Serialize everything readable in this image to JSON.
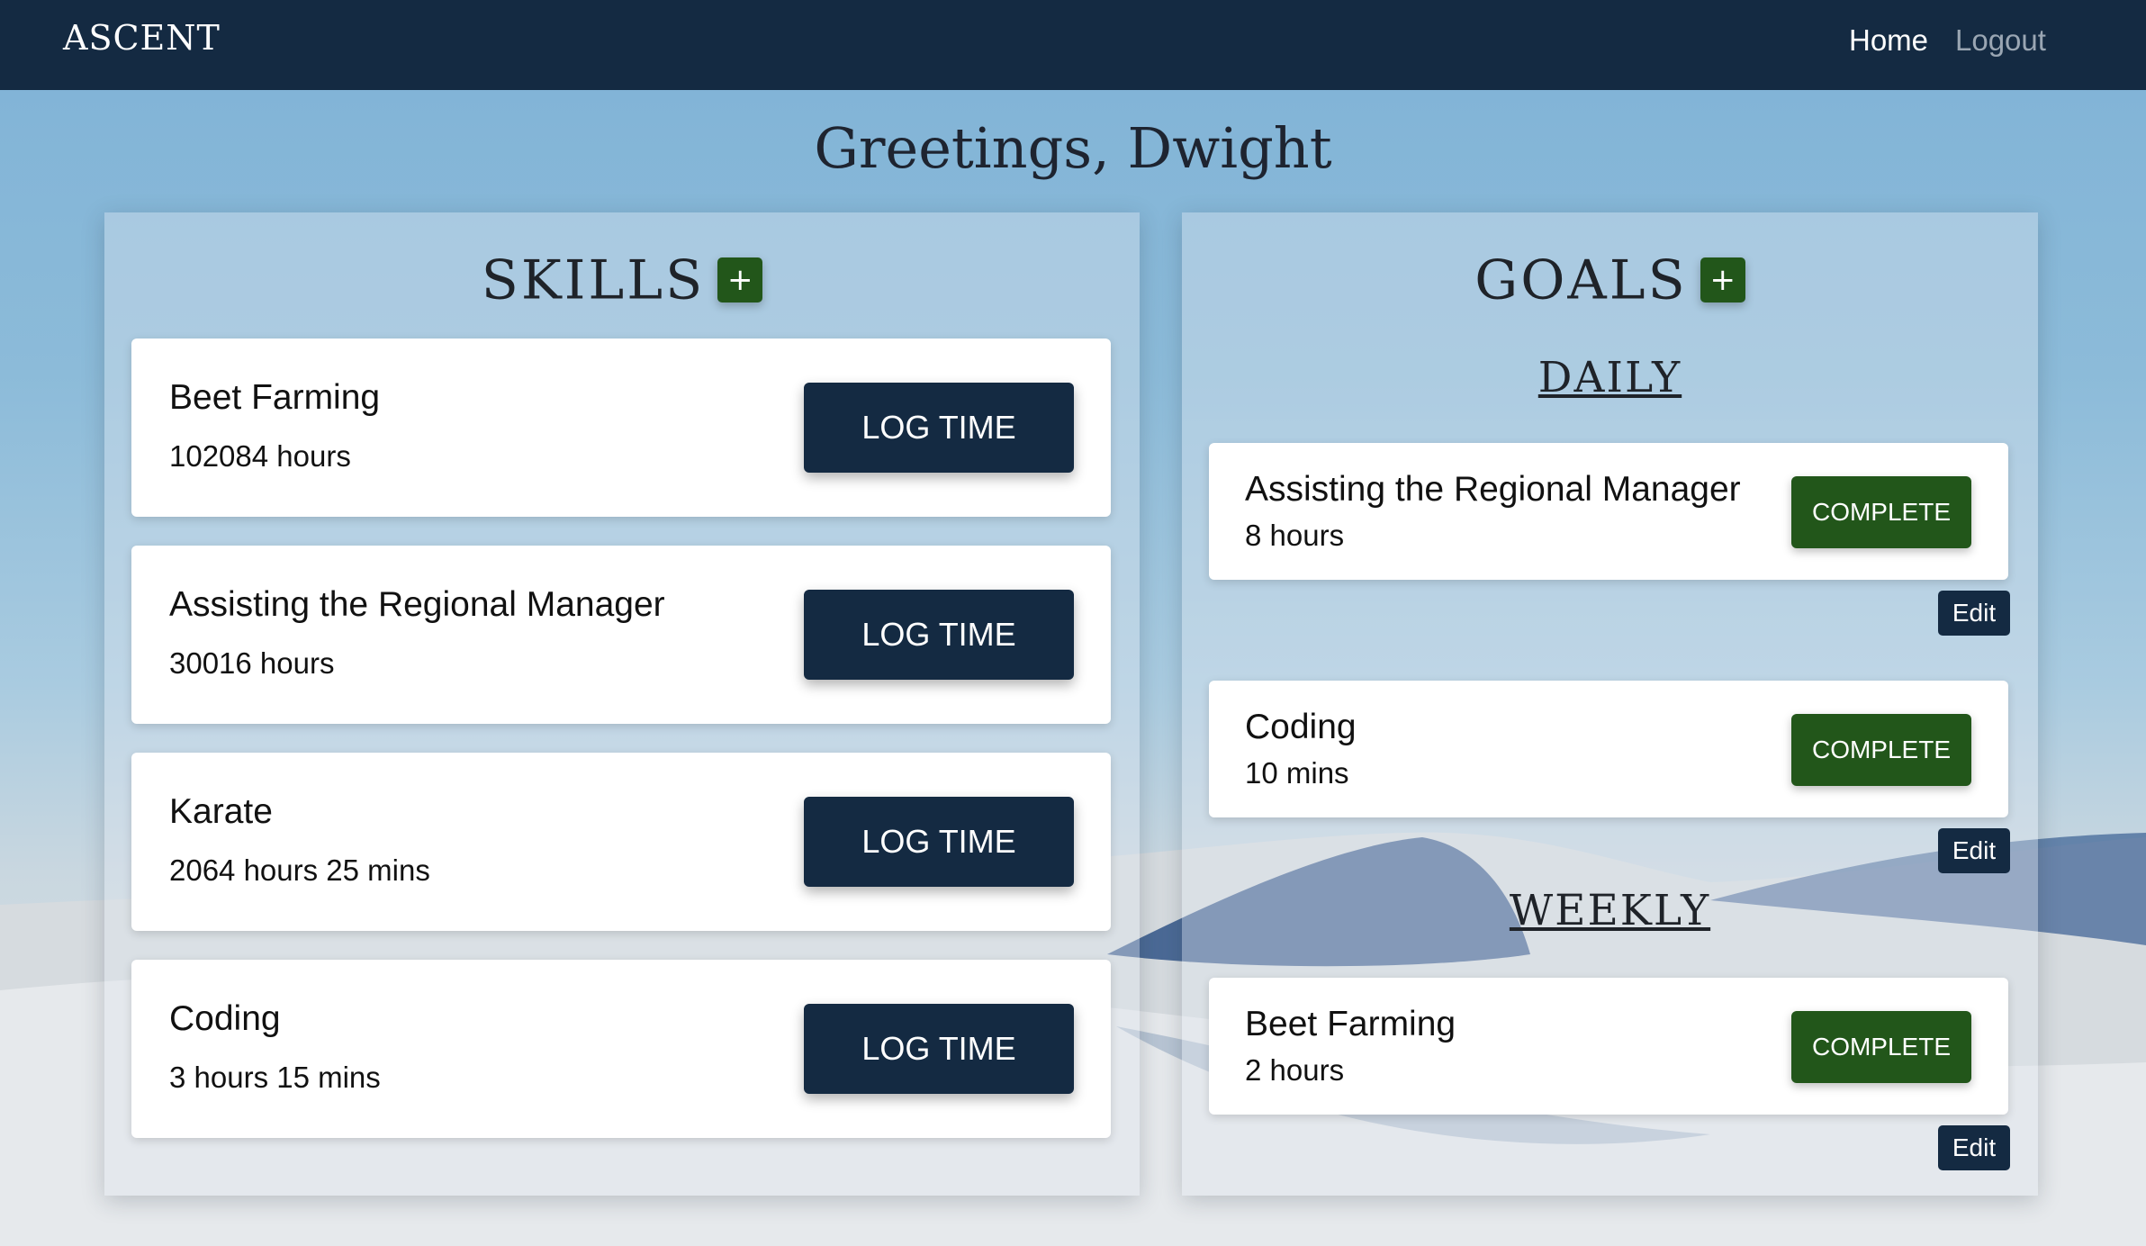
{
  "nav": {
    "brand": "ASCENT",
    "home": "Home",
    "logout": "Logout"
  },
  "greeting": "Greetings, Dwight",
  "skills": {
    "title": "SKILLS",
    "add_label": "+",
    "button_label": "LOG TIME",
    "items": [
      {
        "name": "Beet Farming",
        "time": "102084 hours"
      },
      {
        "name": "Assisting the Regional Manager",
        "time": "30016 hours"
      },
      {
        "name": "Karate",
        "time": "2064 hours 25 mins"
      },
      {
        "name": "Coding",
        "time": "3 hours 15 mins"
      }
    ]
  },
  "goals": {
    "title": "GOALS",
    "add_label": "+",
    "complete_label": "COMPLETE",
    "edit_label": "Edit",
    "daily": {
      "heading": "DAILY",
      "items": [
        {
          "name": "Assisting the Regional Manager",
          "time": "8 hours"
        },
        {
          "name": "Coding",
          "time": "10 mins"
        }
      ]
    },
    "weekly": {
      "heading": "WEEKLY",
      "items": [
        {
          "name": "Beet Farming",
          "time": "2 hours"
        }
      ]
    }
  },
  "colors": {
    "navbar": "#142a42",
    "primary_button": "#142a42",
    "success_button": "#22561a"
  }
}
